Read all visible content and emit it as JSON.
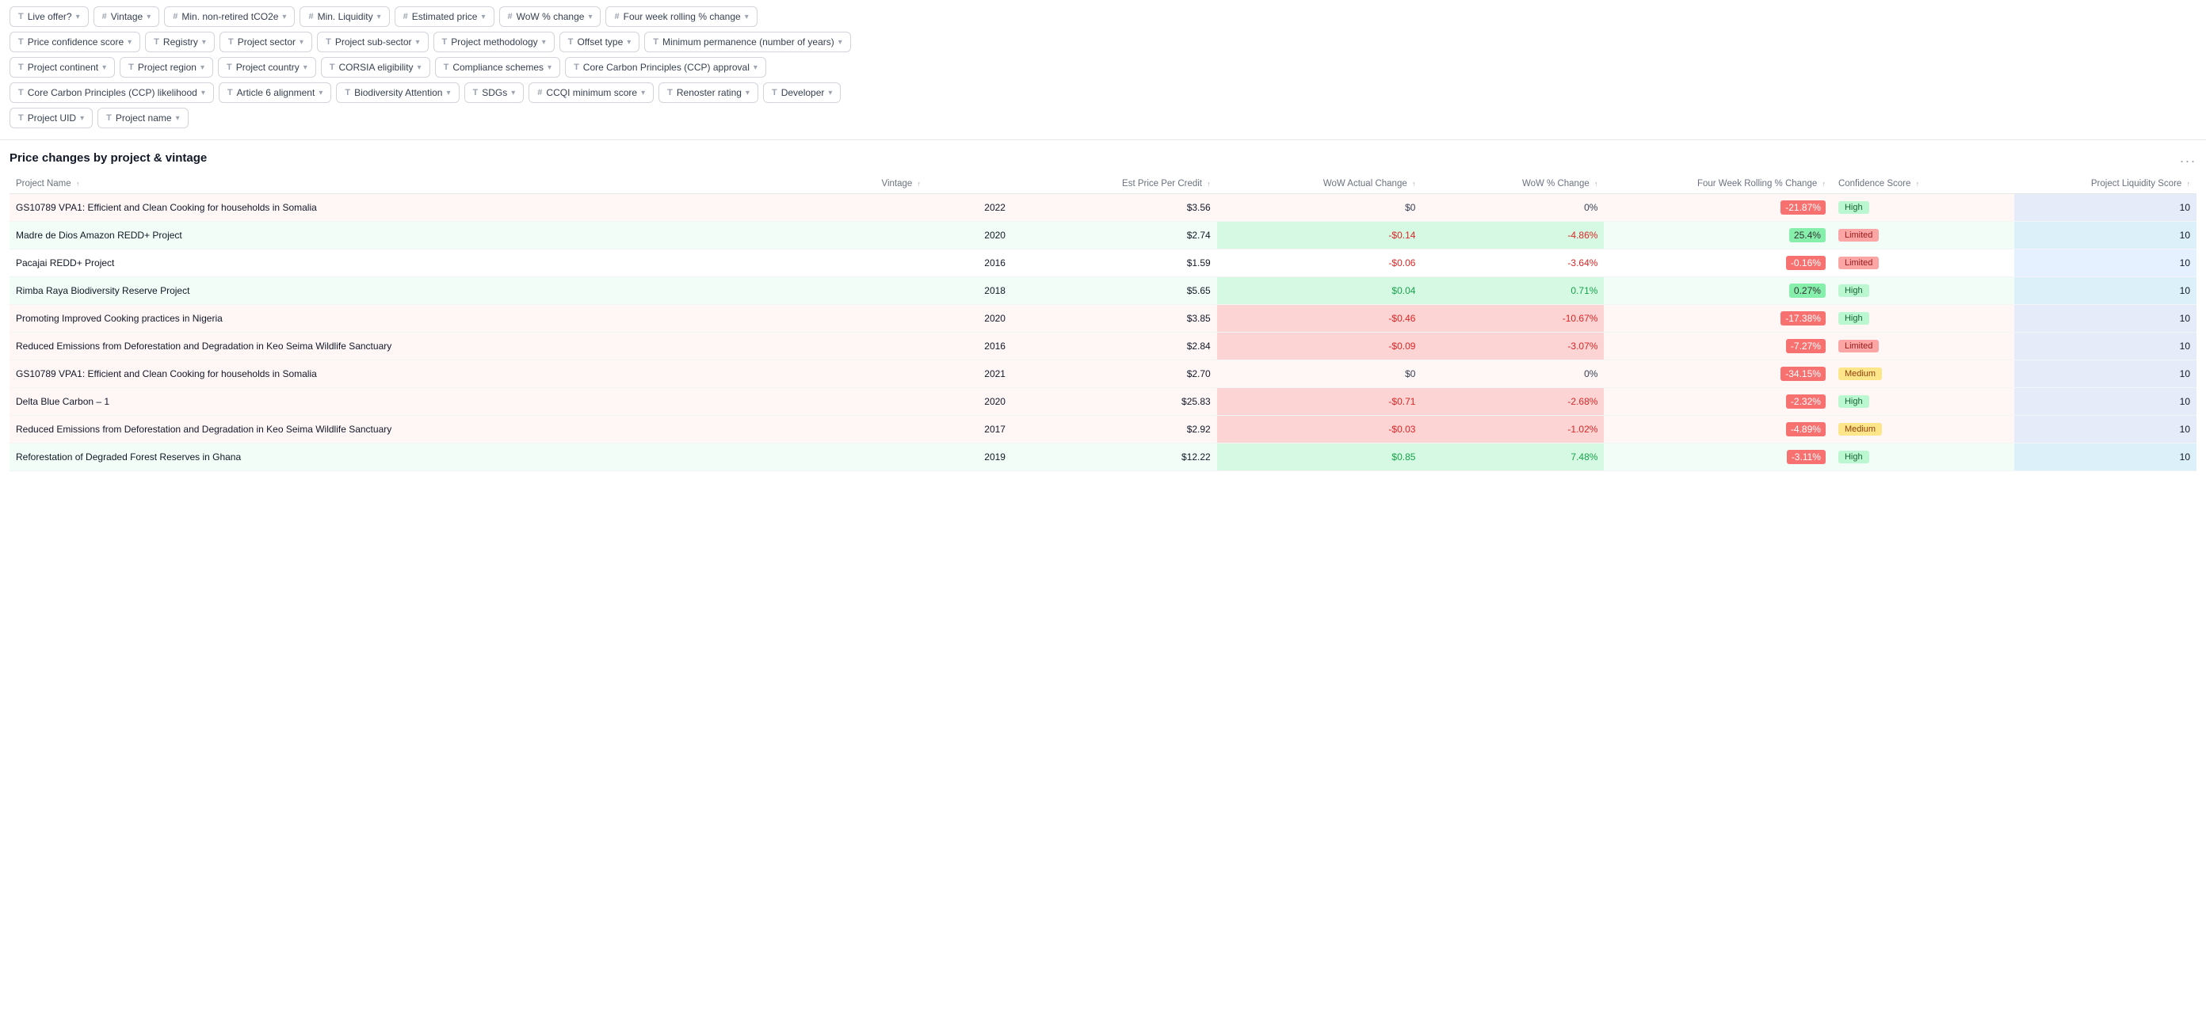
{
  "filters": {
    "row1": [
      {
        "id": "live-offer",
        "icon": "T",
        "label": "Live offer?",
        "hasChevron": true
      },
      {
        "id": "vintage",
        "icon": "#",
        "label": "Vintage",
        "hasChevron": true
      },
      {
        "id": "min-non-retired",
        "icon": "#",
        "label": "Min. non-retired tCO2e",
        "hasChevron": true
      },
      {
        "id": "min-liquidity",
        "icon": "#",
        "label": "Min. Liquidity",
        "hasChevron": true
      },
      {
        "id": "estimated-price",
        "icon": "#",
        "label": "Estimated price",
        "hasChevron": true
      },
      {
        "id": "wow-change",
        "icon": "#",
        "label": "WoW % change",
        "hasChevron": true
      },
      {
        "id": "four-week",
        "icon": "#",
        "label": "Four week rolling % change",
        "hasChevron": true
      }
    ],
    "row2": [
      {
        "id": "price-confidence",
        "icon": "T",
        "label": "Price confidence score",
        "hasChevron": true
      },
      {
        "id": "registry",
        "icon": "T",
        "label": "Registry",
        "hasChevron": true
      },
      {
        "id": "project-sector",
        "icon": "T",
        "label": "Project sector",
        "hasChevron": true
      },
      {
        "id": "project-subsector",
        "icon": "T",
        "label": "Project sub-sector",
        "hasChevron": true
      },
      {
        "id": "project-methodology",
        "icon": "T",
        "label": "Project methodology",
        "hasChevron": true
      },
      {
        "id": "offset-type",
        "icon": "T",
        "label": "Offset type",
        "hasChevron": true
      },
      {
        "id": "min-permanence",
        "icon": "T",
        "label": "Minimum permanence (number of years)",
        "hasChevron": true
      }
    ],
    "row3": [
      {
        "id": "project-continent",
        "icon": "T",
        "label": "Project continent",
        "hasChevron": true
      },
      {
        "id": "project-region",
        "icon": "T",
        "label": "Project region",
        "hasChevron": true
      },
      {
        "id": "project-country",
        "icon": "T",
        "label": "Project country",
        "hasChevron": true
      },
      {
        "id": "corsia",
        "icon": "T",
        "label": "CORSIA eligibility",
        "hasChevron": true
      },
      {
        "id": "compliance",
        "icon": "T",
        "label": "Compliance schemes",
        "hasChevron": true
      },
      {
        "id": "ccp-approval",
        "icon": "T",
        "label": "Core Carbon Principles (CCP) approval",
        "hasChevron": true
      }
    ],
    "row4": [
      {
        "id": "ccp-likelihood",
        "icon": "T",
        "label": "Core Carbon Principles (CCP) likelihood",
        "hasChevron": true
      },
      {
        "id": "article6",
        "icon": "T",
        "label": "Article 6 alignment",
        "hasChevron": true
      },
      {
        "id": "biodiversity",
        "icon": "T",
        "label": "Biodiversity Attention",
        "hasChevron": true
      },
      {
        "id": "sdgs",
        "icon": "T",
        "label": "SDGs",
        "hasChevron": true
      },
      {
        "id": "ccqi",
        "icon": "#",
        "label": "CCQI minimum score",
        "hasChevron": true
      },
      {
        "id": "renoster",
        "icon": "T",
        "label": "Renoster rating",
        "hasChevron": true
      },
      {
        "id": "developer",
        "icon": "T",
        "label": "Developer",
        "hasChevron": true
      }
    ],
    "row5": [
      {
        "id": "project-uid",
        "icon": "T",
        "label": "Project UID",
        "hasChevron": true
      },
      {
        "id": "project-name",
        "icon": "T",
        "label": "Project name",
        "hasChevron": true
      }
    ]
  },
  "table": {
    "title": "Price changes by project & vintage",
    "more_label": "...",
    "columns": [
      {
        "id": "project-name",
        "label": "Project Name",
        "sortable": true
      },
      {
        "id": "vintage",
        "label": "Vintage",
        "sortable": true
      },
      {
        "id": "est-price",
        "label": "Est Price Per Credit",
        "sortable": true
      },
      {
        "id": "wow-actual",
        "label": "WoW Actual Change",
        "sortable": true
      },
      {
        "id": "wow-pct",
        "label": "WoW % Change",
        "sortable": true
      },
      {
        "id": "four-week",
        "label": "Four Week Rolling % Change",
        "sortable": true
      },
      {
        "id": "confidence",
        "label": "Confidence Score",
        "sortable": true
      },
      {
        "id": "liquidity",
        "label": "Project Liquidity Score",
        "sortable": true
      }
    ],
    "rows": [
      {
        "id": "row1",
        "project": "GS10789 VPA1: Efficient and Clean Cooking for households in Somalia",
        "vintage": "2022",
        "est_price": "$3.56",
        "wow_actual": "$0",
        "wow_pct": "0%",
        "four_week": "-21.87%",
        "confidence": "High",
        "confidence_class": "conf-high",
        "liquidity": "10",
        "tint": "red",
        "wow_actual_class": "wow-neutral",
        "wow_pct_class": "wow-neutral",
        "four_week_class": "cell-red"
      },
      {
        "id": "row2",
        "project": "Madre de Dios Amazon REDD+ Project",
        "vintage": "2020",
        "est_price": "$2.74",
        "wow_actual": "-$0.14",
        "wow_pct": "-4.86%",
        "four_week": "25.4%",
        "confidence": "Limited",
        "confidence_class": "conf-limited",
        "liquidity": "10",
        "tint": "green",
        "wow_actual_class": "wow-red",
        "wow_pct_class": "wow-red",
        "four_week_class": "cell-green"
      },
      {
        "id": "row3",
        "project": "Pacajai REDD+ Project",
        "vintage": "2016",
        "est_price": "$1.59",
        "wow_actual": "-$0.06",
        "wow_pct": "-3.64%",
        "four_week": "-0.16%",
        "confidence": "Limited",
        "confidence_class": "conf-limited",
        "liquidity": "10",
        "tint": "none",
        "wow_actual_class": "wow-red",
        "wow_pct_class": "wow-red",
        "four_week_class": "cell-red"
      },
      {
        "id": "row4",
        "project": "Rimba Raya Biodiversity Reserve Project",
        "vintage": "2018",
        "est_price": "$5.65",
        "wow_actual": "$0.04",
        "wow_pct": "0.71%",
        "four_week": "0.27%",
        "confidence": "High",
        "confidence_class": "conf-high",
        "liquidity": "10",
        "tint": "green",
        "wow_actual_class": "wow-green",
        "wow_pct_class": "wow-green",
        "four_week_class": "cell-green"
      },
      {
        "id": "row5",
        "project": "Promoting Improved Cooking practices in Nigeria",
        "vintage": "2020",
        "est_price": "$3.85",
        "wow_actual": "-$0.46",
        "wow_pct": "-10.67%",
        "four_week": "-17.38%",
        "confidence": "High",
        "confidence_class": "conf-high",
        "liquidity": "10",
        "tint": "red",
        "wow_actual_class": "wow-red",
        "wow_pct_class": "wow-red",
        "four_week_class": "cell-red"
      },
      {
        "id": "row6",
        "project": "Reduced Emissions from Deforestation and Degradation in Keo Seima Wildlife Sanctuary",
        "vintage": "2016",
        "est_price": "$2.84",
        "wow_actual": "-$0.09",
        "wow_pct": "-3.07%",
        "four_week": "-7.27%",
        "confidence": "Limited",
        "confidence_class": "conf-limited",
        "liquidity": "10",
        "tint": "red",
        "wow_actual_class": "wow-red",
        "wow_pct_class": "wow-red",
        "four_week_class": "cell-red"
      },
      {
        "id": "row7",
        "project": "GS10789 VPA1: Efficient and Clean Cooking for households in Somalia",
        "vintage": "2021",
        "est_price": "$2.70",
        "wow_actual": "$0",
        "wow_pct": "0%",
        "four_week": "-34.15%",
        "confidence": "Medium",
        "confidence_class": "conf-medium",
        "liquidity": "10",
        "tint": "red",
        "wow_actual_class": "wow-neutral",
        "wow_pct_class": "wow-neutral",
        "four_week_class": "cell-red"
      },
      {
        "id": "row8",
        "project": "Delta Blue Carbon – 1",
        "vintage": "2020",
        "est_price": "$25.83",
        "wow_actual": "-$0.71",
        "wow_pct": "-2.68%",
        "four_week": "-2.32%",
        "confidence": "High",
        "confidence_class": "conf-high",
        "liquidity": "10",
        "tint": "red",
        "wow_actual_class": "wow-red",
        "wow_pct_class": "wow-red",
        "four_week_class": "cell-red"
      },
      {
        "id": "row9",
        "project": "Reduced Emissions from Deforestation and Degradation in Keo Seima Wildlife Sanctuary",
        "vintage": "2017",
        "est_price": "$2.92",
        "wow_actual": "-$0.03",
        "wow_pct": "-1.02%",
        "four_week": "-4.89%",
        "confidence": "Medium",
        "confidence_class": "conf-medium",
        "liquidity": "10",
        "tint": "red",
        "wow_actual_class": "wow-red",
        "wow_pct_class": "wow-red",
        "four_week_class": "cell-red"
      },
      {
        "id": "row10",
        "project": "Reforestation of Degraded Forest Reserves in Ghana",
        "vintage": "2019",
        "est_price": "$12.22",
        "wow_actual": "$0.85",
        "wow_pct": "7.48%",
        "four_week": "-3.11%",
        "confidence": "High",
        "confidence_class": "conf-high",
        "liquidity": "10",
        "tint": "green",
        "wow_actual_class": "wow-green",
        "wow_pct_class": "wow-green",
        "four_week_class": "cell-red"
      }
    ]
  }
}
